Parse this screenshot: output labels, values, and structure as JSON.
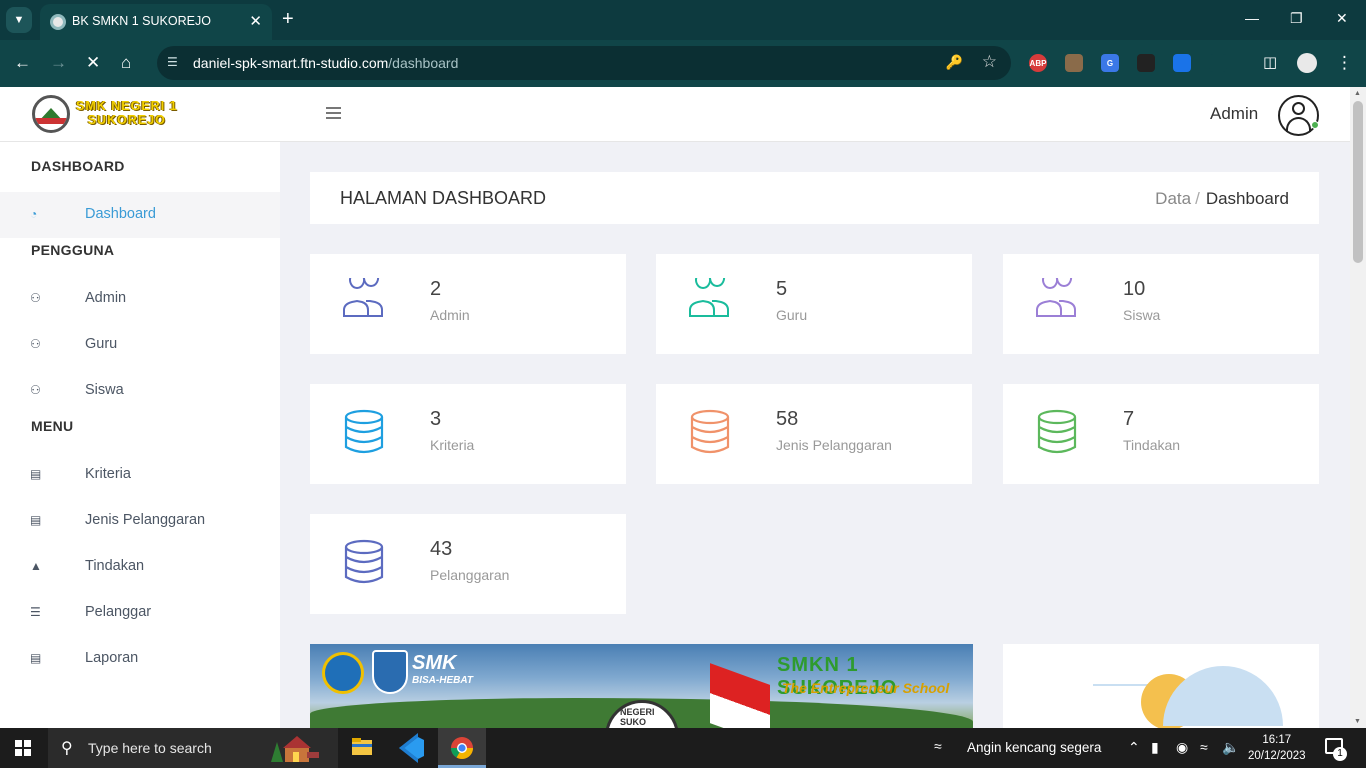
{
  "browser": {
    "tab_title": "BK SMKN 1 SUKOREJO",
    "url_host": "daniel-spk-smart.ftn-studio.com",
    "url_path": "/dashboard",
    "extensions": [
      {
        "name": "adblock-plus-extension",
        "label": "ABP",
        "color": "#d73b3b"
      },
      {
        "name": "owl-extension",
        "label": "",
        "color": "#8a6b4a"
      },
      {
        "name": "google-translate-extension",
        "label": "G",
        "color": "#3b78e7"
      },
      {
        "name": "video-extension",
        "label": "",
        "color": "#222222"
      },
      {
        "name": "settings-extension",
        "label": "",
        "color": "#1a73e8"
      },
      {
        "name": "puzzle-extension",
        "label": "",
        "color": "#104548"
      }
    ]
  },
  "header": {
    "logo_line1": "SMK NEGERI 1",
    "logo_line2": "SUKOREJO",
    "user_name": "Admin"
  },
  "sidebar": {
    "sections": [
      {
        "heading": "DASHBOARD",
        "items": [
          {
            "label": "Dashboard",
            "icon": "tachometer-icon",
            "active": true
          }
        ]
      },
      {
        "heading": "PENGGUNA",
        "items": [
          {
            "label": "Admin",
            "icon": "users-icon"
          },
          {
            "label": "Guru",
            "icon": "users-icon"
          },
          {
            "label": "Siswa",
            "icon": "users-icon"
          }
        ]
      },
      {
        "heading": "MENU",
        "items": [
          {
            "label": "Kriteria",
            "icon": "archive-icon"
          },
          {
            "label": "Jenis Pelanggaran",
            "icon": "archive-icon"
          },
          {
            "label": "Tindakan",
            "icon": "warning-icon"
          },
          {
            "label": "Pelanggar",
            "icon": "list-icon"
          },
          {
            "label": "Laporan",
            "icon": "file-icon"
          }
        ]
      }
    ]
  },
  "content": {
    "page_title": "HALAMAN DASHBOARD",
    "breadcrumb": {
      "parent": "Data",
      "separator": "/",
      "current": "Dashboard"
    }
  },
  "cards": [
    {
      "count": "2",
      "label": "Admin",
      "icon": "users-outline-icon",
      "color": "#5c6bc0"
    },
    {
      "count": "5",
      "label": "Guru",
      "icon": "users-outline-icon",
      "color": "#1abc9c"
    },
    {
      "count": "10",
      "label": "Siswa",
      "icon": "users-outline-icon",
      "color": "#9b7fd6"
    },
    {
      "count": "3",
      "label": "Kriteria",
      "icon": "database-icon",
      "color": "#1e9fe0"
    },
    {
      "count": "58",
      "label": "Jenis Pelanggaran",
      "icon": "database-icon",
      "color": "#f0926a"
    },
    {
      "count": "7",
      "label": "Tindakan",
      "icon": "database-icon",
      "color": "#5cb85c"
    },
    {
      "count": "43",
      "label": "Pelanggaran",
      "icon": "database-icon",
      "color": "#5c6bc0"
    }
  ],
  "banner": {
    "smk_text": "SMK",
    "smk_sub": "BISA-HEBAT",
    "school_name": "SMKN 1 SUKOREJO",
    "tagline": "The Entrepreneur School",
    "emblem_text": "NEGERI SUKO"
  },
  "taskbar": {
    "search_placeholder": "Type here to search",
    "weather_text": "Angin kencang segera",
    "time": "16:17",
    "date": "20/12/2023",
    "notification_count": "1"
  }
}
